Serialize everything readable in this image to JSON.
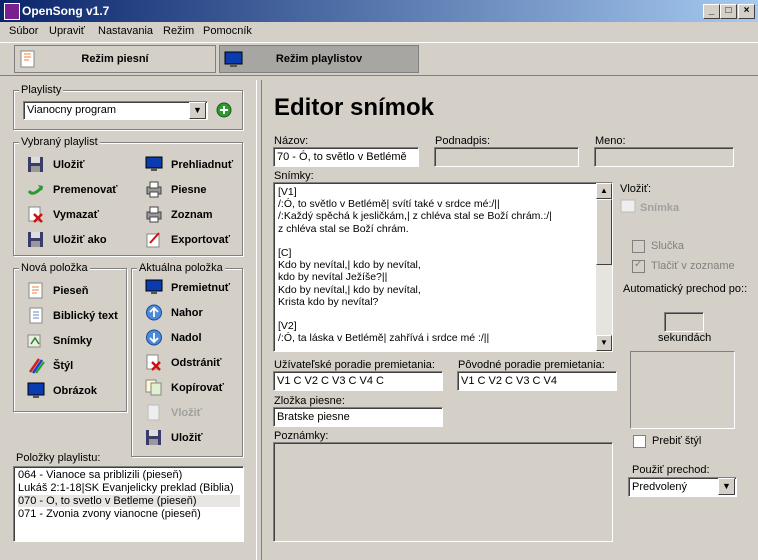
{
  "window": {
    "title": "OpenSong v1.7"
  },
  "menu": [
    "Súbor",
    "Upraviť",
    "Nastavania",
    "Režim",
    "Pomocník"
  ],
  "modes": {
    "song_mode": "Režim piesní",
    "playlist_mode": "Režim playlistov"
  },
  "playlists": {
    "label": "Playlisty",
    "selected": "Vianocny program"
  },
  "selected_playlist": {
    "label": "Vybraný playlist",
    "buttons": [
      "Uložiť",
      "Prehliadnuť",
      "Premenovať",
      "Piesne",
      "Vymazať",
      "Zoznam",
      "Uložiť ako",
      "Exportovať"
    ]
  },
  "new_item": {
    "label": "Nová položka",
    "buttons": [
      "Pieseň",
      "Biblický text",
      "Snímky",
      "Štýl",
      "Obrázok"
    ]
  },
  "current_item": {
    "label": "Aktuálna položka",
    "buttons": [
      "Premietnuť",
      "Nahor",
      "Nadol",
      "Odstrániť",
      "Kopírovať",
      "Vložiť",
      "Uložiť"
    ]
  },
  "playlist_items": {
    "label": "Položky playlistu:",
    "items": [
      "064 - Vianoce sa priblizili (pieseň)",
      "Lukáš 2:1-18|SK Evanjelicky preklad (Biblia)",
      "070 - O, to svetlo v Betleme (pieseň)",
      "071 - Zvonia zvony vianocne (pieseň)"
    ],
    "selected_index": 2
  },
  "editor": {
    "heading": "Editor snímok",
    "name_label": "Názov:",
    "name_value": "70 - Ó, to světlo v Betlémě",
    "subtitle_label": "Podnadpis:",
    "subtitle_value": "",
    "meno_label": "Meno:",
    "meno_value": "",
    "slides_label": "Snímky:",
    "slides_lines": [
      "[V1]",
      "/:Ó, to světlo v Betlémě| svítí také v srdce mé:/||",
      "/:Každý spěchá k jesličkám,| z chléva stal se Boží chrám.:/|",
      "z chléva stal se Boží chrám.",
      "",
      "[C]",
      " Kdo by nevítal,| kdo by nevítal,",
      "kdo by nevítal Ježíše?||",
      " Kdo by nevítal,| kdo by nevítal,",
      " Krista kdo by nevítal?",
      "",
      "[V2]",
      "/:Ó, ta láska v Betlémě| zahřívá i srdce mé :/||"
    ],
    "user_order_label": "Užívateľské poradie premietania:",
    "user_order_value": "V1 C V2 C V3 C V4 C",
    "orig_order_label": "Pôvodné poradie premietania:",
    "orig_order_value": "V1 C V2 C V3 C V4",
    "folder_label": "Zložka piesne:",
    "folder_value": "Bratske piesne",
    "notes_label": "Poznámky:",
    "notes_value": ""
  },
  "right_panel": {
    "insert_label": "Vložiť:",
    "slide_btn": "Snímka",
    "loop_label": "Slučka",
    "print_label": "Tlačiť v zozname",
    "auto_label": "Automatický prechod po::",
    "seconds_label": "sekundách",
    "override_style_label": "Prebiť štýl",
    "transition_label": "Použiť prechod:",
    "transition_value": "Predvolený"
  }
}
